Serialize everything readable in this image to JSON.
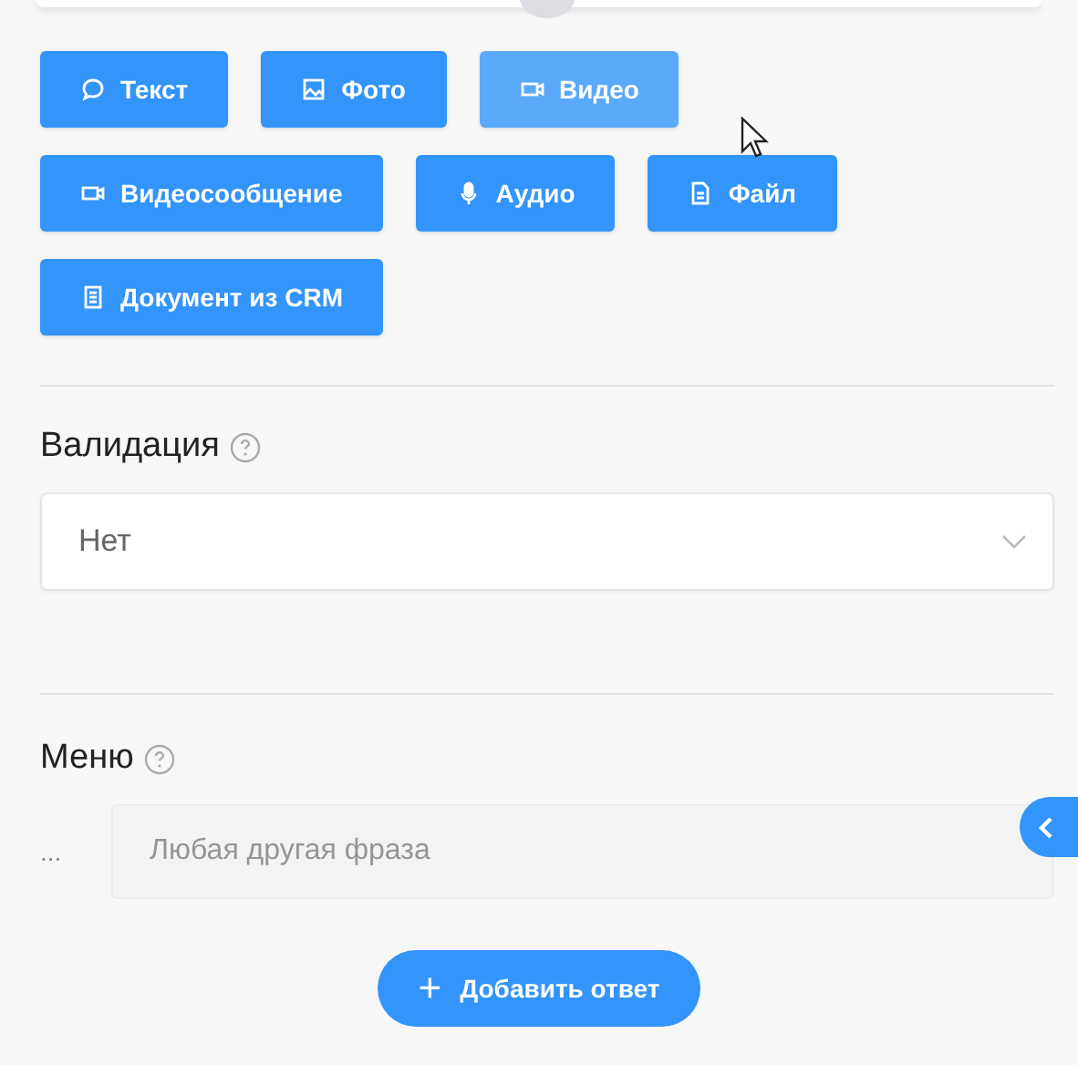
{
  "message_types": [
    {
      "label": "Текст",
      "kind": "text",
      "hovered": false
    },
    {
      "label": "Фото",
      "kind": "photo",
      "hovered": false
    },
    {
      "label": "Видео",
      "kind": "video",
      "hovered": true
    },
    {
      "label": "Видеосообщение",
      "kind": "video",
      "hovered": false
    },
    {
      "label": "Аудио",
      "kind": "audio",
      "hovered": false
    },
    {
      "label": "Файл",
      "kind": "file",
      "hovered": false
    },
    {
      "label": "Документ из CRM",
      "kind": "document",
      "hovered": false
    }
  ],
  "validation": {
    "label": "Валидация",
    "value": "Нет"
  },
  "menu": {
    "label": "Меню",
    "marker": "...",
    "placeholder": "Любая другая фраза"
  },
  "add_button": {
    "icon": "+",
    "label": "Добавить ответ"
  }
}
